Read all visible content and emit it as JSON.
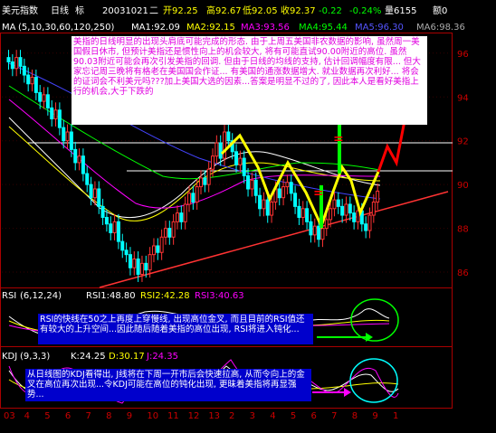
{
  "header": {
    "instrument": "美元指数",
    "period": "日线",
    "mark": "标",
    "date": "20031021",
    "weekday": "二",
    "open": "开92.25",
    "high": "高92.67",
    "low": "低92.05",
    "close": "收92.37",
    "change": "-0.22",
    "change_pct": "-0.24%",
    "volume": "量6155",
    "amount": "额0"
  },
  "ma_legend": {
    "label": "MA",
    "params": "(5,10,30,60,120,250)",
    "ma1": "MA1:92.09",
    "ma2": "MA2:92.15",
    "ma3": "MA3:93.56",
    "ma4": "MA4:95.44",
    "ma5": "MA5:96.30",
    "ma6": "MA6:98.36"
  },
  "rsi_legend": {
    "label": "RSI",
    "params": "(6,12,24)",
    "rsi1": "RSI1:48.80",
    "rsi2": "RSI2:42.28",
    "rsi3": "RSI3:40.63"
  },
  "kdj_legend": {
    "label": "KDJ",
    "params": "(9,3,3)",
    "k": "K:24.25",
    "d": "D:30.17",
    "j": "J:24.35"
  },
  "notes": {
    "main": "美指的日线明显的出现头肩底可能完成的形态. 由于上周五美国非农数据的影响, 虽然周一美国假日休市, 但预计美指还是惯性向上的机会较大, 将有可能直试90.00附近的高位. 虽然90.03附近可能会再次引发美指的回调. 但由于日线的均线的支持, 估计回调幅度有限... 但大家忘记周三晚将有格老在美国国会作证... 有美国的通涨数据增大. 就业数据再次利好... 将会的证词会不利美元吗???加上美国大选的因素...答案是明显不过的了, 因此本人是看好美指上行的机会,大于下跌的",
    "rsi": "RSI的快线在50之上再度上穿慢线, 出现高位金叉, 而且目前的RSI值还有较大的上升空间...因此随后随着美指的高位出现, RSI将进入钝化...",
    "kdj": "从日线图的KDJ看得出, J线将在下周一开市后会快速拉高, 从而令向上的金叉在高位再次出现...令KDJ可能在高位的钝化出现, 更昧着美指将再显强势..."
  },
  "colors": {
    "note_bg": "#ffffff",
    "note_text_main": "#e000e0",
    "note_text_sub": "#ffffff",
    "note_bg_sub": "#0000cc",
    "pattern": "#ffff00",
    "neckline": "#00ff00",
    "arrow": "#ff0000",
    "trendline": "#ff3333",
    "up_candle": "#ff3333",
    "down_candle": "#00ffff"
  },
  "chart_data": {
    "type": "candlestick",
    "title": "",
    "ylim": [
      85.3,
      96.9
    ],
    "y_ticks": [
      86,
      88,
      90,
      92,
      94,
      96
    ],
    "x_ticks": [
      "03",
      "4",
      "5",
      "6",
      "7",
      "8",
      "9",
      "10",
      "11",
      "12",
      "13",
      "2",
      "3",
      "4",
      "5",
      "6",
      "7",
      "8",
      "9",
      "1"
    ],
    "resistance_levels": [
      91.5,
      90.0
    ],
    "closes": [
      95.6,
      95.3,
      95.8,
      95.4,
      95.0,
      94.6,
      94.9,
      94.2,
      93.8,
      94.1,
      93.5,
      93.0,
      93.4,
      92.6,
      92.0,
      92.4,
      91.6,
      91.0,
      91.3,
      90.5,
      90.0,
      89.4,
      89.8,
      89.0,
      88.5,
      88.2,
      87.8,
      88.3,
      87.4,
      87.0,
      86.8,
      86.2,
      86.6,
      85.9,
      86.4,
      86.1,
      86.8,
      87.2,
      86.9,
      87.6,
      88.0,
      87.6,
      88.3,
      88.7,
      88.3,
      89.1,
      89.6,
      89.2,
      89.9,
      90.3,
      90.0,
      90.7,
      91.3,
      91.9,
      91.2,
      92.4,
      92.0,
      91.5,
      90.9,
      91.2,
      90.4,
      89.8,
      90.2,
      89.5,
      88.9,
      89.3,
      88.6,
      89.2,
      89.8,
      89.4,
      89.9,
      90.1,
      89.6,
      89.0,
      88.5,
      88.9,
      88.3,
      87.7,
      88.1,
      87.5,
      88.0,
      88.4,
      88.9,
      89.3,
      89.0,
      88.6,
      89.1,
      88.7,
      88.3,
      88.8,
      88.2,
      87.9,
      88.6,
      89.2,
      89.7
    ]
  }
}
